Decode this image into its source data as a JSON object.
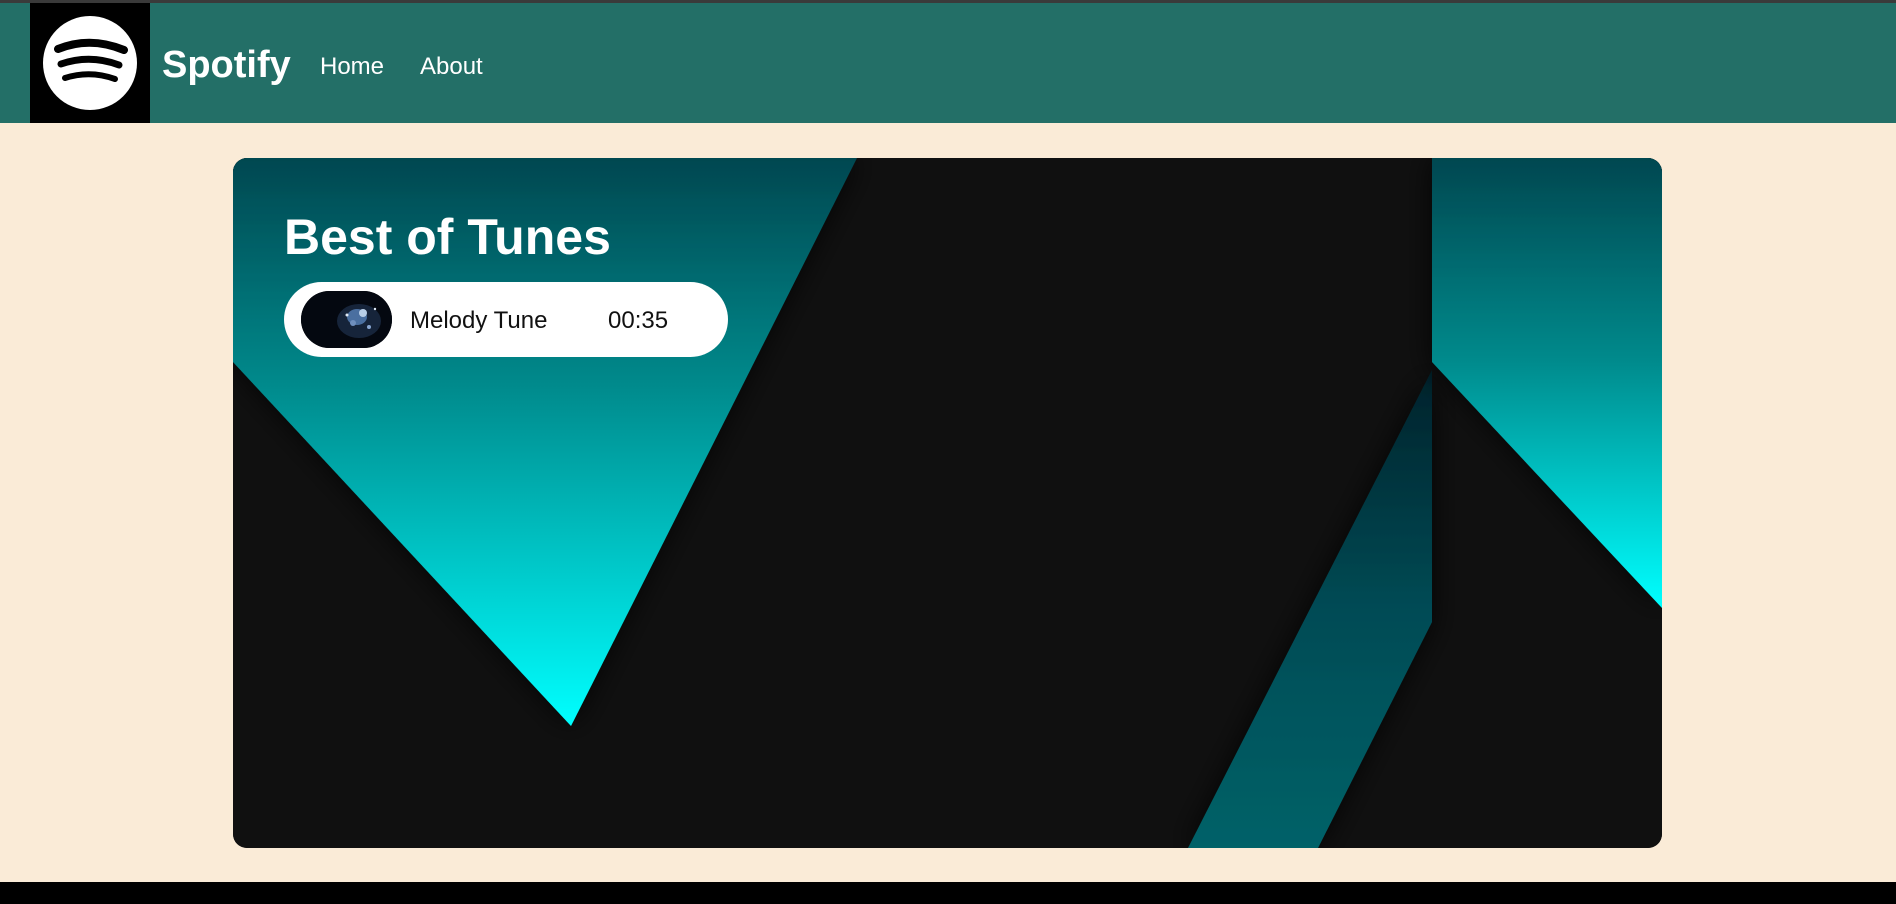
{
  "navbar": {
    "logo_icon": "spotify-logo-icon",
    "brand": "Spotify",
    "links": [
      {
        "label": "Home"
      },
      {
        "label": "About"
      }
    ]
  },
  "playlist": {
    "title": "Best of Tunes",
    "songs": [
      {
        "thumbnail": "song-cover-image",
        "name": "Melody Tune",
        "duration": "00:35"
      }
    ]
  },
  "colors": {
    "navbar": "#236f67",
    "page_background": "#faebd7",
    "card_dark": "#101010",
    "accent_cyan": "#00ffff",
    "accent_teal_dark": "#024a52"
  }
}
